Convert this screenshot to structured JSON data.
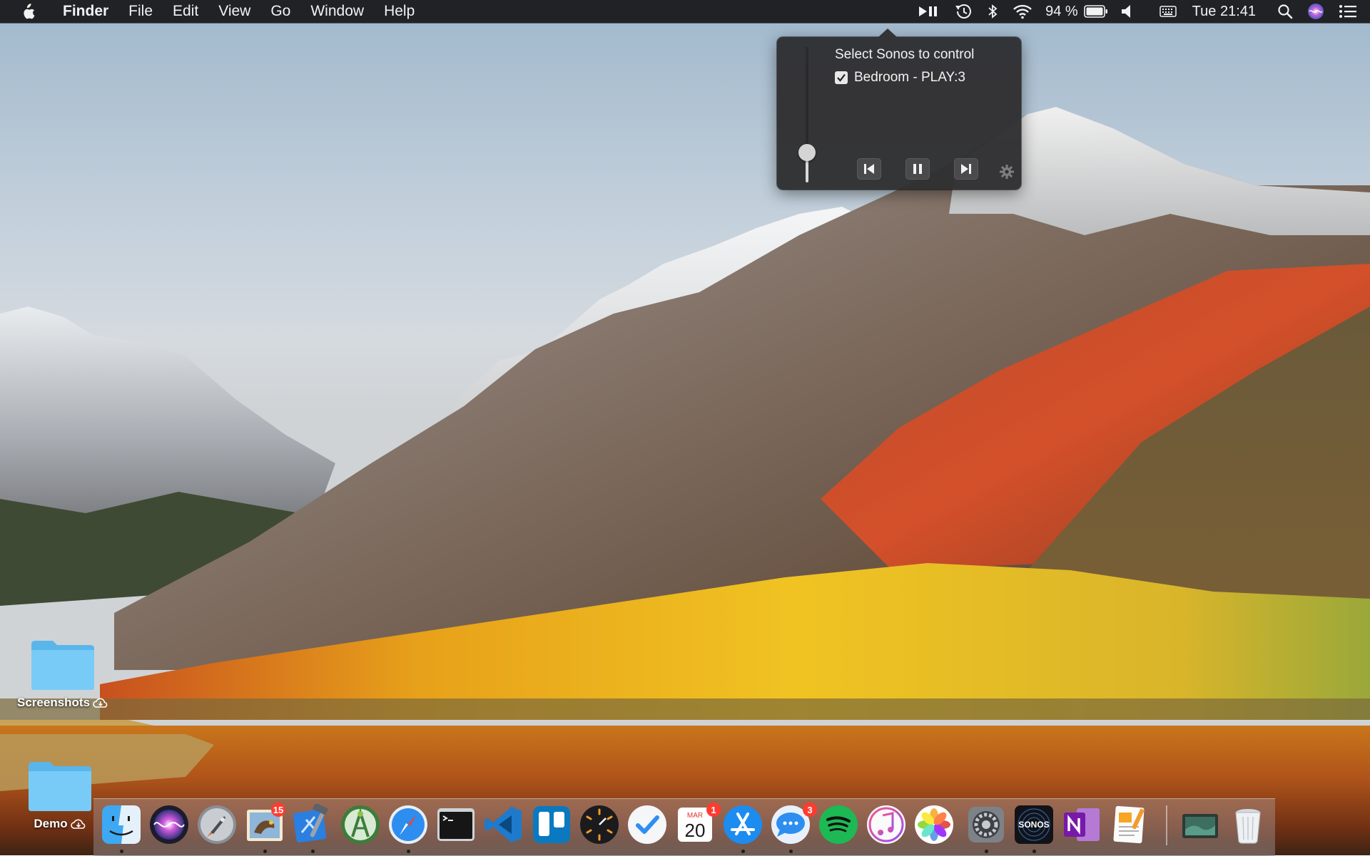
{
  "menubar": {
    "apple_icon": "apple-logo-icon",
    "app_name": "Finder",
    "menus": [
      "File",
      "Edit",
      "View",
      "Go",
      "Window",
      "Help"
    ],
    "status": {
      "play_pause_icon": "play-pause-icon",
      "time_machine_icon": "time-machine-icon",
      "bluetooth_icon": "bluetooth-icon",
      "wifi_icon": "wifi-icon",
      "battery_percent": "94 %",
      "battery_icon": "battery-icon",
      "volume_icon": "volume-icon",
      "keyboard_icon": "keyboard-icon",
      "clock": "Tue 21:41",
      "spotlight_icon": "search-icon",
      "siri_icon": "siri-icon",
      "notification_icon": "notification-center-icon"
    }
  },
  "sonos_popover": {
    "title": "Select Sonos to control",
    "speakers": [
      {
        "label": "Bedroom - PLAY:3",
        "checked": true
      }
    ],
    "volume_fraction": 0.22,
    "controls": [
      "previous-track-icon",
      "pause-icon",
      "next-track-icon",
      "gear-icon"
    ]
  },
  "desktop": {
    "icons": [
      {
        "label": "Screenshots",
        "icon": "folder-icon",
        "badge_icon": "icloud-icon"
      },
      {
        "label": "Demo",
        "icon": "folder-icon",
        "badge_icon": "icloud-icon"
      }
    ]
  },
  "dock": {
    "apps": [
      {
        "name": "finder-icon",
        "running": true
      },
      {
        "name": "siri-icon",
        "running": false
      },
      {
        "name": "launchpad-icon",
        "running": false
      },
      {
        "name": "mail-icon",
        "running": true,
        "badge": "15"
      },
      {
        "name": "xcode-icon",
        "running": true
      },
      {
        "name": "android-studio-icon",
        "running": false
      },
      {
        "name": "safari-icon",
        "running": true
      },
      {
        "name": "terminal-icon",
        "running": false
      },
      {
        "name": "vscode-icon",
        "running": false
      },
      {
        "name": "trello-icon",
        "running": false
      },
      {
        "name": "clock-app-icon",
        "running": false
      },
      {
        "name": "things-icon",
        "running": false
      },
      {
        "name": "calendar-icon",
        "running": false,
        "badge": "1",
        "month": "MAR",
        "day": "20"
      },
      {
        "name": "app-store-icon",
        "running": true
      },
      {
        "name": "messages-icon",
        "running": true,
        "badge": "3"
      },
      {
        "name": "spotify-icon",
        "running": false
      },
      {
        "name": "itunes-icon",
        "running": false
      },
      {
        "name": "photos-icon",
        "running": false
      },
      {
        "name": "system-preferences-icon",
        "running": true
      },
      {
        "name": "sonos-icon",
        "running": true,
        "label": "SONOS"
      },
      {
        "name": "onenote-icon",
        "running": false
      },
      {
        "name": "pages-icon",
        "running": false
      },
      {
        "name": "downloads-stack-icon",
        "running": false
      },
      {
        "name": "trash-icon",
        "running": false
      }
    ]
  }
}
